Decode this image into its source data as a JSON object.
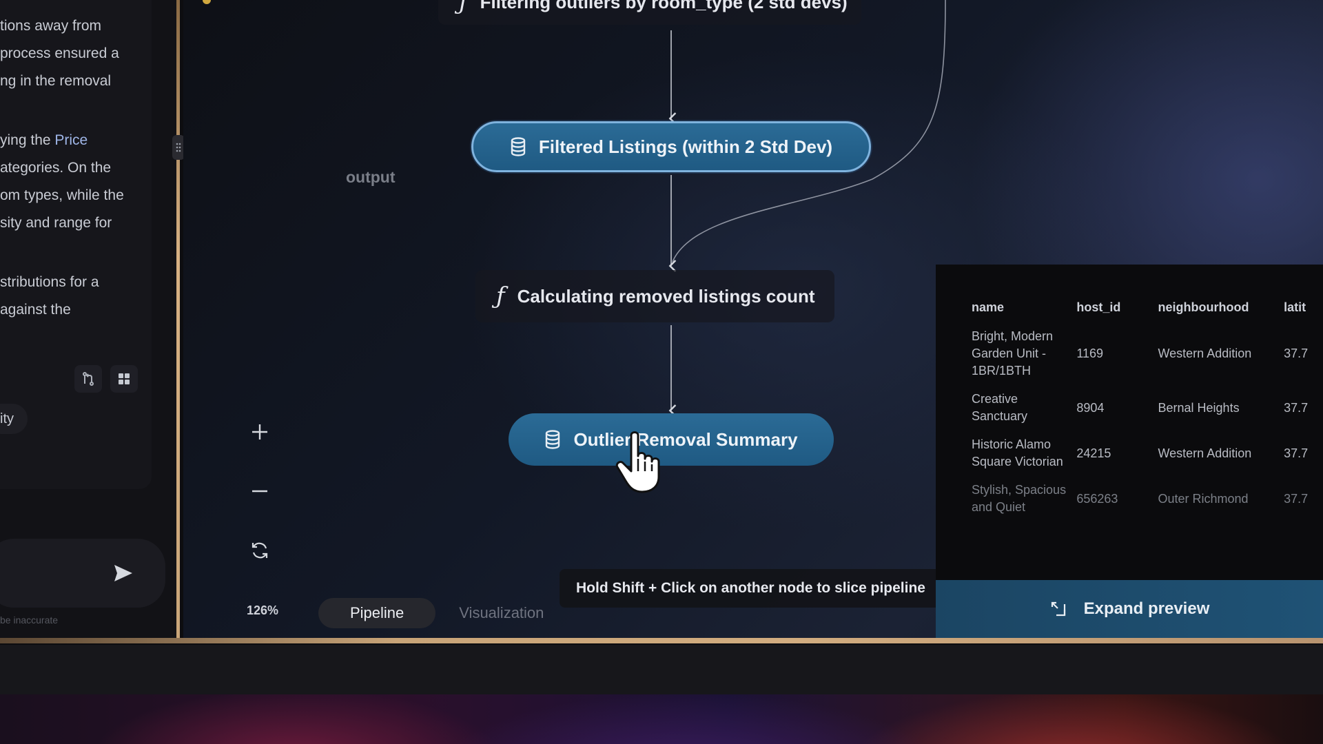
{
  "chat": {
    "lines_top": [
      "tions away from",
      "process ensured a",
      "ng in the removal"
    ],
    "para2_prefix": "ying the ",
    "para2_highlight": "Price",
    "lines_mid": [
      "ategories. On the",
      "om types, while the",
      "sity and range for"
    ],
    "lines_bottom": [
      "stributions for a",
      "against the"
    ],
    "chip_label": "ity",
    "disclaimer": "be inaccurate"
  },
  "pipeline": {
    "nodes": {
      "top_function": "Filtering outliers by room_type (2 std devs)",
      "filtered": "Filtered Listings (within 2 Std Dev)",
      "calc": "Calculating removed listings count",
      "summary": "Outlier Removal Summary"
    },
    "output_label": "output",
    "zoom": "126%",
    "tabs": [
      "Pipeline",
      "Visualization"
    ],
    "active_tab": "Pipeline",
    "hint": "Hold Shift + Click on another node to slice pipeline"
  },
  "preview": {
    "columns": [
      "name",
      "host_id",
      "neighbourhood",
      "latit"
    ],
    "rows": [
      {
        "name": "Bright, Modern Garden Unit - 1BR/1BTH",
        "host_id": "1169",
        "neighbourhood": "Western Addition",
        "lat": "37.7"
      },
      {
        "name": "Creative Sanctuary",
        "host_id": "8904",
        "neighbourhood": "Bernal Heights",
        "lat": "37.7"
      },
      {
        "name": "Historic Alamo Square Victorian",
        "host_id": "24215",
        "neighbourhood": "Western Addition",
        "lat": "37.7"
      },
      {
        "name": "Stylish, Spacious and Quiet",
        "host_id": "656263",
        "neighbourhood": "Outer Richmond",
        "lat": "37.7"
      }
    ],
    "expand_label": "Expand preview"
  },
  "colors": {
    "node_fill": "#2b6b96",
    "node_border": "#7fb3de",
    "window_frame": "#d2ad80",
    "expand_bar": "#1f5275"
  },
  "icons": [
    "database-icon",
    "function-icon",
    "plus-icon",
    "minus-icon",
    "refresh-icon",
    "send-icon",
    "expand-icon",
    "branch-icon",
    "grid-icon",
    "hand-cursor-icon",
    "drag-handle-icon"
  ]
}
